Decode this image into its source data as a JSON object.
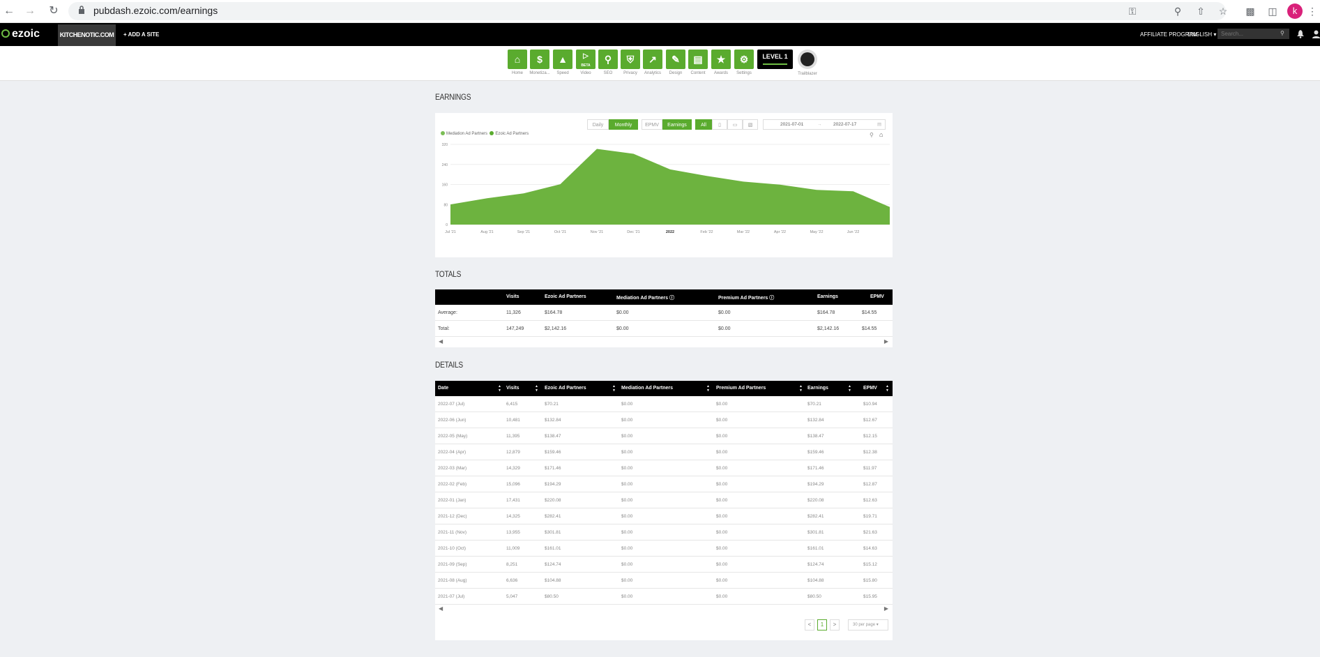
{
  "browser": {
    "url": "pubdash.ezoic.com/earnings",
    "profile_initial": "k"
  },
  "ezbar": {
    "logo": "ezoic",
    "site": "KITCHENOTIC.COM",
    "add_site": "+ ADD A SITE",
    "affiliate": "AFFILIATE PROGRAM",
    "language": "ENGLISH",
    "search_placeholder": "Search..."
  },
  "tools": [
    {
      "label": "Home",
      "icon": "home-icon"
    },
    {
      "label": "Monetiza...",
      "icon": "dollar-icon"
    },
    {
      "label": "Speed",
      "icon": "rocket-icon"
    },
    {
      "label": "Video",
      "icon": "video-icon",
      "badge": "BETA"
    },
    {
      "label": "SEO",
      "icon": "magnifier-icon"
    },
    {
      "label": "Privacy",
      "icon": "shield-icon"
    },
    {
      "label": "Analytics",
      "icon": "chart-icon"
    },
    {
      "label": "Design",
      "icon": "pencil-icon"
    },
    {
      "label": "Content",
      "icon": "document-icon"
    },
    {
      "label": "Awards",
      "icon": "trophy-icon"
    },
    {
      "label": "Settings",
      "icon": "gear-icon"
    }
  ],
  "level": "LEVEL 1",
  "trailblazer": "Trailblazer",
  "earnings": {
    "heading": "EARNINGS",
    "controls": {
      "daily": "Daily",
      "monthly": "Monthly",
      "epmv": "EPMV",
      "earnings": "Earnings",
      "all": "All"
    },
    "date_from": "2021-07-01",
    "date_sep": "→",
    "date_to": "2022-07-17",
    "legend": [
      "Mediation Ad Partners",
      "Ezoic Ad Partners"
    ],
    "colors": {
      "mediation": "#7bbd55",
      "ezoic": "#5aab2e",
      "area": "#6db33f"
    }
  },
  "chart_data": {
    "type": "area",
    "title": "",
    "xlabel": "",
    "ylabel": "",
    "x_tick_labels": [
      "Jul '21",
      "Aug '21",
      "Sep '21",
      "Oct '21",
      "Nov '21",
      "Dec '21",
      "2022",
      "Feb '22",
      "Mar '22",
      "Apr '22",
      "May '22",
      "Jun '22"
    ],
    "y_tick_labels": [
      "0",
      "80",
      "160",
      "240",
      "320"
    ],
    "ylim": [
      0,
      320
    ],
    "grid": true,
    "legend_position": "top-left",
    "categories": [
      "2021-07",
      "2021-08",
      "2021-09",
      "2021-10",
      "2021-11",
      "2021-12",
      "2022-01",
      "2022-02",
      "2022-03",
      "2022-04",
      "2022-05",
      "2022-06",
      "2022-07"
    ],
    "series": [
      {
        "name": "Mediation Ad Partners",
        "values": [
          0,
          0,
          0,
          0,
          0,
          0,
          0,
          0,
          0,
          0,
          0,
          0,
          0
        ]
      },
      {
        "name": "Ezoic Ad Partners",
        "values": [
          80.5,
          104.88,
          124.74,
          161.01,
          301.81,
          282.41,
          220.08,
          194.29,
          171.46,
          159.46,
          138.47,
          132.84,
          70.21
        ]
      }
    ]
  },
  "totals": {
    "heading": "TOTALS",
    "columns": [
      "Visits",
      "Ezoic Ad Partners",
      "Mediation Ad Partners",
      "Premium Ad Partners",
      "Earnings",
      "EPMV"
    ],
    "rows": [
      {
        "label": "Average:",
        "values": [
          "11,326",
          "$164.78",
          "$0.00",
          "$0.00",
          "$164.78",
          "$14.55"
        ]
      },
      {
        "label": "Total:",
        "values": [
          "147,249",
          "$2,142.16",
          "$0.00",
          "$0.00",
          "$2,142.16",
          "$14.55"
        ]
      }
    ]
  },
  "details": {
    "heading": "DETAILS",
    "columns": [
      "Date",
      "Visits",
      "Ezoic Ad Partners",
      "Mediation Ad Partners",
      "Premium Ad Partners",
      "Earnings",
      "EPMV"
    ],
    "rows": [
      [
        "2022-07 (Jul)",
        "6,415",
        "$70.21",
        "$0.00",
        "$0.00",
        "$70.21",
        "$10.94"
      ],
      [
        "2022-06 (Jun)",
        "10,481",
        "$132.84",
        "$0.00",
        "$0.00",
        "$132.84",
        "$12.67"
      ],
      [
        "2022-05 (May)",
        "11,395",
        "$138.47",
        "$0.00",
        "$0.00",
        "$138.47",
        "$12.15"
      ],
      [
        "2022-04 (Apr)",
        "12,879",
        "$159.46",
        "$0.00",
        "$0.00",
        "$159.46",
        "$12.38"
      ],
      [
        "2022-03 (Mar)",
        "14,329",
        "$171.46",
        "$0.00",
        "$0.00",
        "$171.46",
        "$11.97"
      ],
      [
        "2022-02 (Feb)",
        "15,096",
        "$194.29",
        "$0.00",
        "$0.00",
        "$194.29",
        "$12.87"
      ],
      [
        "2022-01 (Jan)",
        "17,431",
        "$220.08",
        "$0.00",
        "$0.00",
        "$220.08",
        "$12.63"
      ],
      [
        "2021-12 (Dec)",
        "14,325",
        "$282.41",
        "$0.00",
        "$0.00",
        "$282.41",
        "$19.71"
      ],
      [
        "2021-11 (Nov)",
        "13,955",
        "$301.81",
        "$0.00",
        "$0.00",
        "$301.81",
        "$21.63"
      ],
      [
        "2021-10 (Oct)",
        "11,009",
        "$161.01",
        "$0.00",
        "$0.00",
        "$161.01",
        "$14.63"
      ],
      [
        "2021-09 (Sep)",
        "8,251",
        "$124.74",
        "$0.00",
        "$0.00",
        "$124.74",
        "$15.12"
      ],
      [
        "2021-08 (Aug)",
        "6,636",
        "$104.88",
        "$0.00",
        "$0.00",
        "$104.88",
        "$15.80"
      ],
      [
        "2021-07 (Jul)",
        "5,047",
        "$80.50",
        "$0.00",
        "$0.00",
        "$80.50",
        "$15.95"
      ]
    ],
    "pager": {
      "prev": "<",
      "page": "1",
      "next": ">",
      "per_page": "30 per page"
    }
  }
}
